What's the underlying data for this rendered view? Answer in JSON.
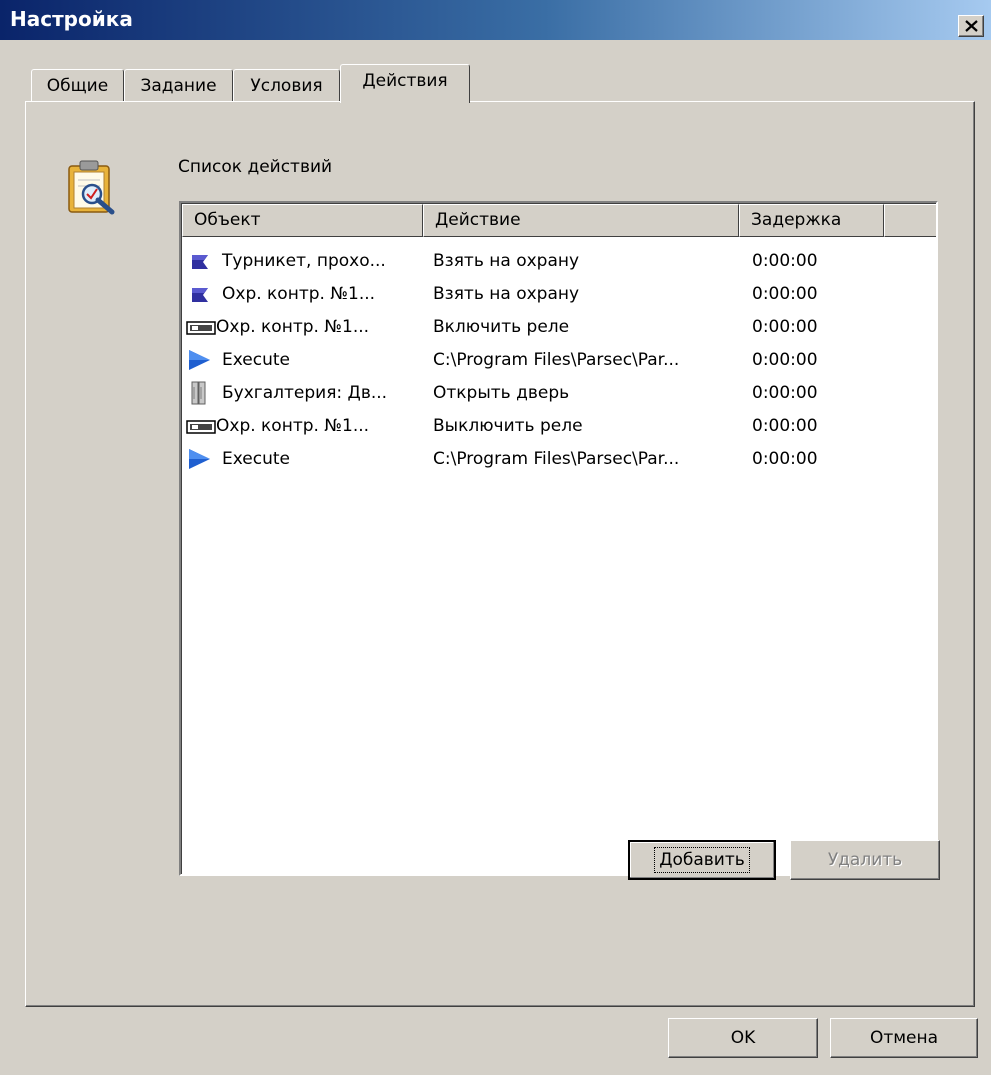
{
  "window": {
    "title": "Настройка"
  },
  "tabs": [
    {
      "label": "Общие"
    },
    {
      "label": "Задание"
    },
    {
      "label": "Условия"
    },
    {
      "label": "Действия"
    }
  ],
  "section": {
    "label": "Список действий",
    "icon": "clipboard-magnifier-icon"
  },
  "list": {
    "columns": [
      "Объект",
      "Действие",
      "Задержка"
    ],
    "rows": [
      {
        "icon": "turnstile-icon",
        "object": "Турникет, прохо...",
        "action": "Взять на охрану",
        "delay": "0:00:00"
      },
      {
        "icon": "turnstile-icon",
        "object": "Охр. контр. №1...",
        "action": "Взять на охрану",
        "delay": "0:00:00"
      },
      {
        "icon": "relay-icon",
        "object": "Охр. контр. №1...",
        "action": "Включить реле",
        "delay": "0:00:00"
      },
      {
        "icon": "execute-icon",
        "object": "Execute",
        "action": "C:\\Program Files\\Parsec\\Par...",
        "delay": "0:00:00"
      },
      {
        "icon": "door-icon",
        "object": "Бухгалтерия: Дв...",
        "action": "Открыть дверь",
        "delay": "0:00:00"
      },
      {
        "icon": "relay-icon",
        "object": "Охр. контр. №1...",
        "action": "Выключить реле",
        "delay": "0:00:00"
      },
      {
        "icon": "execute-icon",
        "object": "Execute",
        "action": "C:\\Program Files\\Parsec\\Par...",
        "delay": "0:00:00"
      }
    ]
  },
  "buttons": {
    "add": "Добавить",
    "remove": "Удалить",
    "ok": "OK",
    "cancel": "Отмена"
  },
  "colors": {
    "titlebar_start": "#0a246a",
    "titlebar_end": "#a6caf0",
    "face": "#d4d0c8",
    "icon_blue": "#1f5fd0",
    "icon_indigo": "#3030a0"
  }
}
